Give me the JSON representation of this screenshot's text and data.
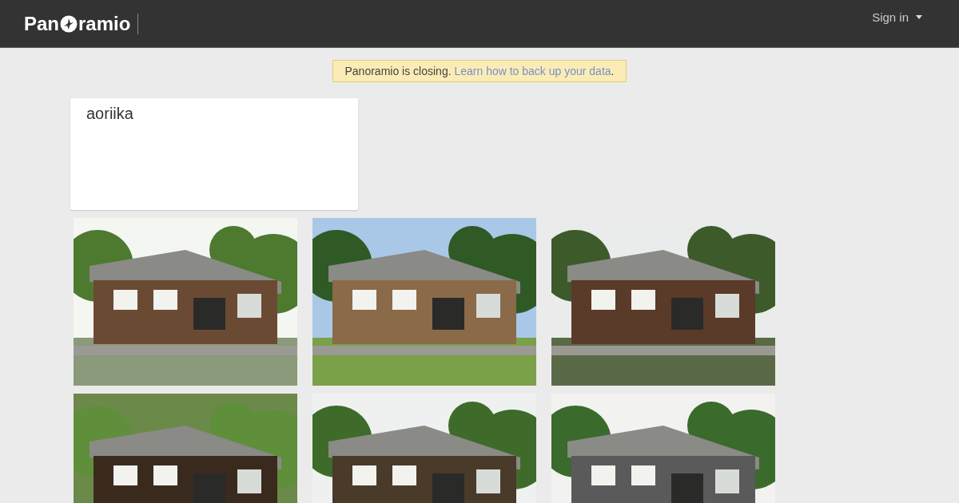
{
  "header": {
    "logo": [
      "Pan",
      "ramio"
    ],
    "sign_in": "Sign in"
  },
  "notice": {
    "text": "Panoramio is closing.",
    "link": "Learn how to back up your data",
    "end": "."
  },
  "profile": {
    "name": "aoriika"
  }
}
